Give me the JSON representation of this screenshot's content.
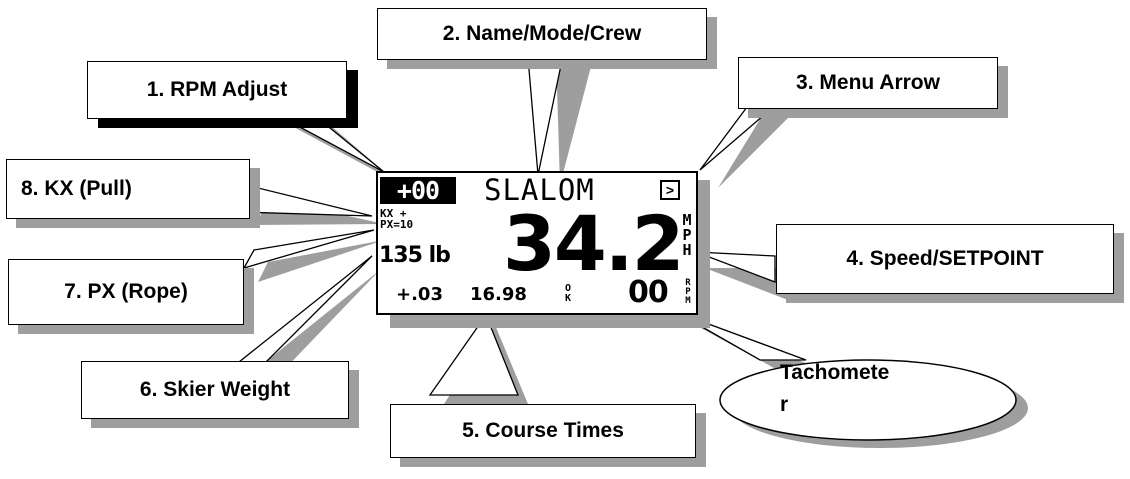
{
  "callouts": {
    "rpm_adjust": "1. RPM Adjust",
    "name_mode_crew": "2. Name/Mode/Crew",
    "menu_arrow": "3. Menu Arrow",
    "speed_setpoint": "4. Speed/SETPOINT",
    "course_times": "5. Course Times",
    "skier_weight": "6. Skier Weight",
    "px_rope": "7. PX (Rope)",
    "kx_pull": "8. KX (Pull)",
    "tachometer_line1": "Tachomete",
    "tachometer_line2": "r"
  },
  "lcd": {
    "rpm_adjust": "+00",
    "mode": "SLALOM",
    "menu_arrow_glyph": ">",
    "kx": "KX +",
    "px": "PX=10",
    "weight": "135 lb",
    "speed": "34.2",
    "speed_unit": "MPH",
    "course_delta": "+.03",
    "course_time": "16.98",
    "course_ok": "OK",
    "tach": "00",
    "tach_unit": "RPM"
  },
  "colors": {
    "shadow": "#9e9e9e",
    "ink": "#000000",
    "paper": "#ffffff"
  }
}
